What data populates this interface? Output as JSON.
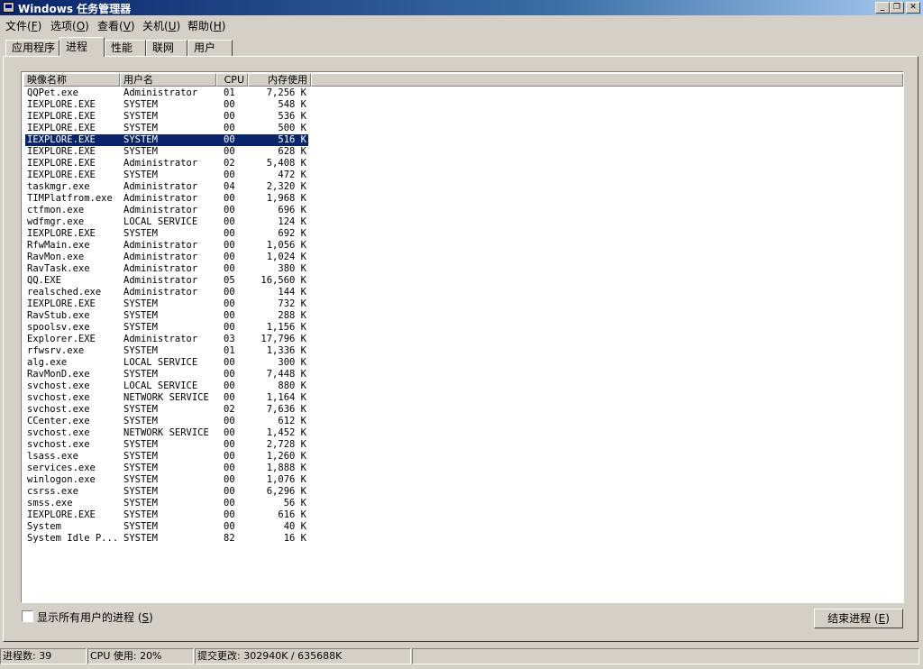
{
  "window": {
    "title": "Windows 任务管理器",
    "minimize_glyph": "_",
    "maximize_glyph": "❐",
    "close_glyph": "✕"
  },
  "menu": [
    {
      "label": "文件(",
      "key": "F",
      "suffix": ")"
    },
    {
      "label": "选项(",
      "key": "O",
      "suffix": ")"
    },
    {
      "label": "查看(",
      "key": "V",
      "suffix": ")"
    },
    {
      "label": "关机(",
      "key": "U",
      "suffix": ")"
    },
    {
      "label": "帮助(",
      "key": "H",
      "suffix": ")"
    }
  ],
  "tabs": [
    "应用程序",
    "进程",
    "性能",
    "联网",
    "用户"
  ],
  "active_tab": "进程",
  "columns": [
    "映像名称",
    "用户名",
    "CPU",
    "内存使用"
  ],
  "processes": [
    {
      "name": "QQPet.exe",
      "user": "Administrator",
      "cpu": "01",
      "mem": "7,256 K"
    },
    {
      "name": "IEXPLORE.EXE",
      "user": "SYSTEM",
      "cpu": "00",
      "mem": "548 K"
    },
    {
      "name": "IEXPLORE.EXE",
      "user": "SYSTEM",
      "cpu": "00",
      "mem": "536 K"
    },
    {
      "name": "IEXPLORE.EXE",
      "user": "SYSTEM",
      "cpu": "00",
      "mem": "500 K"
    },
    {
      "name": "IEXPLORE.EXE",
      "user": "SYSTEM",
      "cpu": "00",
      "mem": "516 K",
      "selected": true
    },
    {
      "name": "IEXPLORE.EXE",
      "user": "SYSTEM",
      "cpu": "00",
      "mem": "628 K"
    },
    {
      "name": "IEXPLORE.EXE",
      "user": "Administrator",
      "cpu": "02",
      "mem": "5,408 K"
    },
    {
      "name": "IEXPLORE.EXE",
      "user": "SYSTEM",
      "cpu": "00",
      "mem": "472 K"
    },
    {
      "name": "taskmgr.exe",
      "user": "Administrator",
      "cpu": "04",
      "mem": "2,320 K"
    },
    {
      "name": "TIMPlatfrom.exe",
      "user": "Administrator",
      "cpu": "00",
      "mem": "1,968 K"
    },
    {
      "name": "ctfmon.exe",
      "user": "Administrator",
      "cpu": "00",
      "mem": "696 K"
    },
    {
      "name": "wdfmgr.exe",
      "user": "LOCAL SERVICE",
      "cpu": "00",
      "mem": "124 K"
    },
    {
      "name": "IEXPLORE.EXE",
      "user": "SYSTEM",
      "cpu": "00",
      "mem": "692 K"
    },
    {
      "name": "RfwMain.exe",
      "user": "Administrator",
      "cpu": "00",
      "mem": "1,056 K"
    },
    {
      "name": "RavMon.exe",
      "user": "Administrator",
      "cpu": "00",
      "mem": "1,024 K"
    },
    {
      "name": "RavTask.exe",
      "user": "Administrator",
      "cpu": "00",
      "mem": "380 K"
    },
    {
      "name": "QQ.EXE",
      "user": "Administrator",
      "cpu": "05",
      "mem": "16,560 K"
    },
    {
      "name": "realsched.exe",
      "user": "Administrator",
      "cpu": "00",
      "mem": "144 K"
    },
    {
      "name": "IEXPLORE.EXE",
      "user": "SYSTEM",
      "cpu": "00",
      "mem": "732 K"
    },
    {
      "name": "RavStub.exe",
      "user": "SYSTEM",
      "cpu": "00",
      "mem": "288 K"
    },
    {
      "name": "spoolsv.exe",
      "user": "SYSTEM",
      "cpu": "00",
      "mem": "1,156 K"
    },
    {
      "name": "Explorer.EXE",
      "user": "Administrator",
      "cpu": "03",
      "mem": "17,796 K"
    },
    {
      "name": "rfwsrv.exe",
      "user": "SYSTEM",
      "cpu": "01",
      "mem": "1,336 K"
    },
    {
      "name": "alg.exe",
      "user": "LOCAL SERVICE",
      "cpu": "00",
      "mem": "300 K"
    },
    {
      "name": "RavMonD.exe",
      "user": "SYSTEM",
      "cpu": "00",
      "mem": "7,448 K"
    },
    {
      "name": "svchost.exe",
      "user": "LOCAL SERVICE",
      "cpu": "00",
      "mem": "880 K"
    },
    {
      "name": "svchost.exe",
      "user": "NETWORK SERVICE",
      "cpu": "00",
      "mem": "1,164 K"
    },
    {
      "name": "svchost.exe",
      "user": "SYSTEM",
      "cpu": "02",
      "mem": "7,636 K"
    },
    {
      "name": "CCenter.exe",
      "user": "SYSTEM",
      "cpu": "00",
      "mem": "612 K"
    },
    {
      "name": "svchost.exe",
      "user": "NETWORK SERVICE",
      "cpu": "00",
      "mem": "1,452 K"
    },
    {
      "name": "svchost.exe",
      "user": "SYSTEM",
      "cpu": "00",
      "mem": "2,728 K"
    },
    {
      "name": "lsass.exe",
      "user": "SYSTEM",
      "cpu": "00",
      "mem": "1,260 K"
    },
    {
      "name": "services.exe",
      "user": "SYSTEM",
      "cpu": "00",
      "mem": "1,888 K"
    },
    {
      "name": "winlogon.exe",
      "user": "SYSTEM",
      "cpu": "00",
      "mem": "1,076 K"
    },
    {
      "name": "csrss.exe",
      "user": "SYSTEM",
      "cpu": "00",
      "mem": "6,296 K"
    },
    {
      "name": "smss.exe",
      "user": "SYSTEM",
      "cpu": "00",
      "mem": "56 K"
    },
    {
      "name": "IEXPLORE.EXE",
      "user": "SYSTEM",
      "cpu": "00",
      "mem": "616 K"
    },
    {
      "name": "System",
      "user": "SYSTEM",
      "cpu": "00",
      "mem": "40 K"
    },
    {
      "name": "System Idle P...",
      "user": "SYSTEM",
      "cpu": "82",
      "mem": "16 K"
    }
  ],
  "show_all_users": {
    "label": "显示所有用户的进程 (",
    "key": "S",
    "suffix": ")",
    "checked": false
  },
  "end_process_button": {
    "label": "结束进程 (",
    "key": "E",
    "suffix": ")"
  },
  "status": {
    "process_count": "进程数: 39",
    "cpu_usage": "CPU 使用: 20%",
    "commit_charge": "提交更改: 302940K / 635688K"
  }
}
